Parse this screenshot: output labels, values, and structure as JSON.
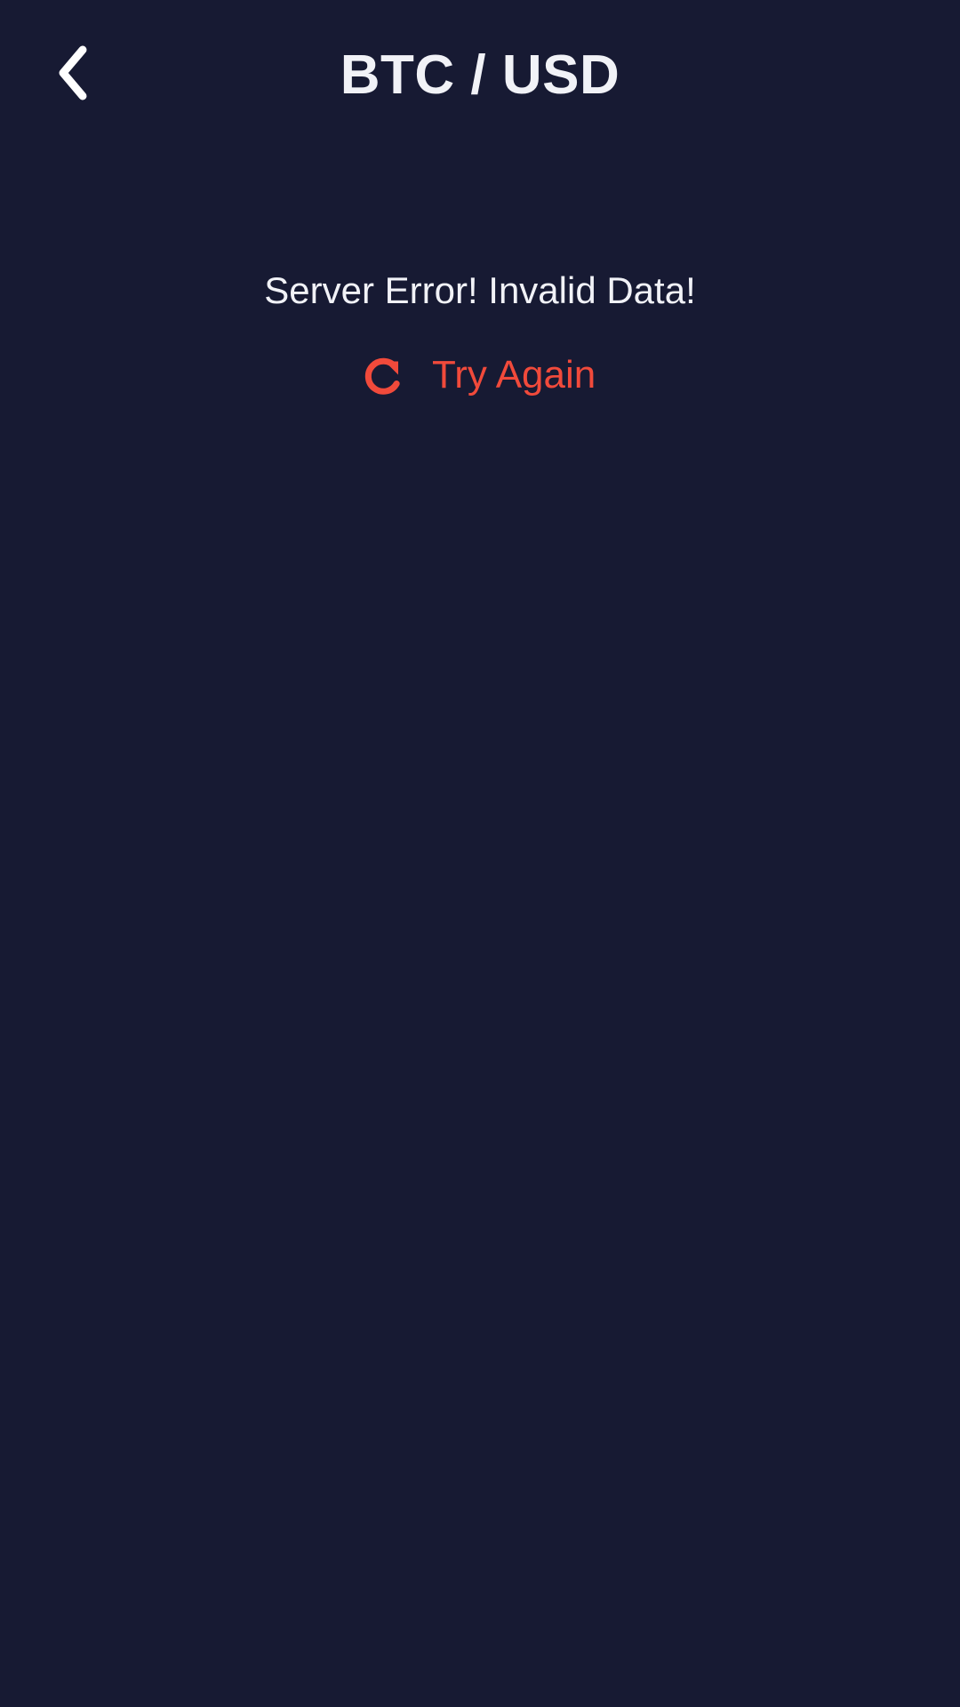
{
  "header": {
    "title": "BTC / USD",
    "back_icon": "chevron-left-icon"
  },
  "error": {
    "message": "Server Error! Invalid Data!"
  },
  "retry": {
    "label": "Try Again",
    "icon": "refresh-icon"
  },
  "colors": {
    "background": "#171a33",
    "text": "#f1f2f7",
    "accent": "#f14a3b"
  }
}
